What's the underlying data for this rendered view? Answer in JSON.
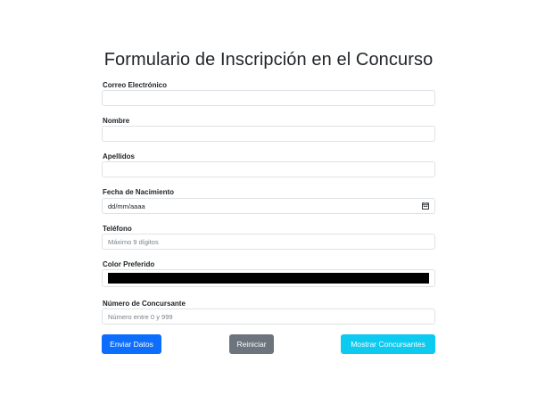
{
  "form": {
    "title": "Formulario de Inscripción en el Concurso",
    "email_label": "Correo Electrónico",
    "name_label": "Nombre",
    "surname_label": "Apellidos",
    "birthdate_label": "Fecha de Nacimiento",
    "birthdate_value": "dd/mm/aaaa",
    "phone_label": "Teléfono",
    "phone_placeholder": "Máximo 9 dígitos",
    "color_label": "Color Preferido",
    "color_value": "#000000",
    "contestant_number_label": "Número de Concursante",
    "contestant_number_placeholder": "Número entre 0 y 999"
  },
  "buttons": {
    "submit_label": "Enviar Datos",
    "reset_label": "Reiniciar",
    "show_label": "Mostrar Concursantes"
  },
  "colors": {
    "primary": "#0d6efd",
    "secondary": "#6c757d",
    "info": "#0dcaf0"
  }
}
